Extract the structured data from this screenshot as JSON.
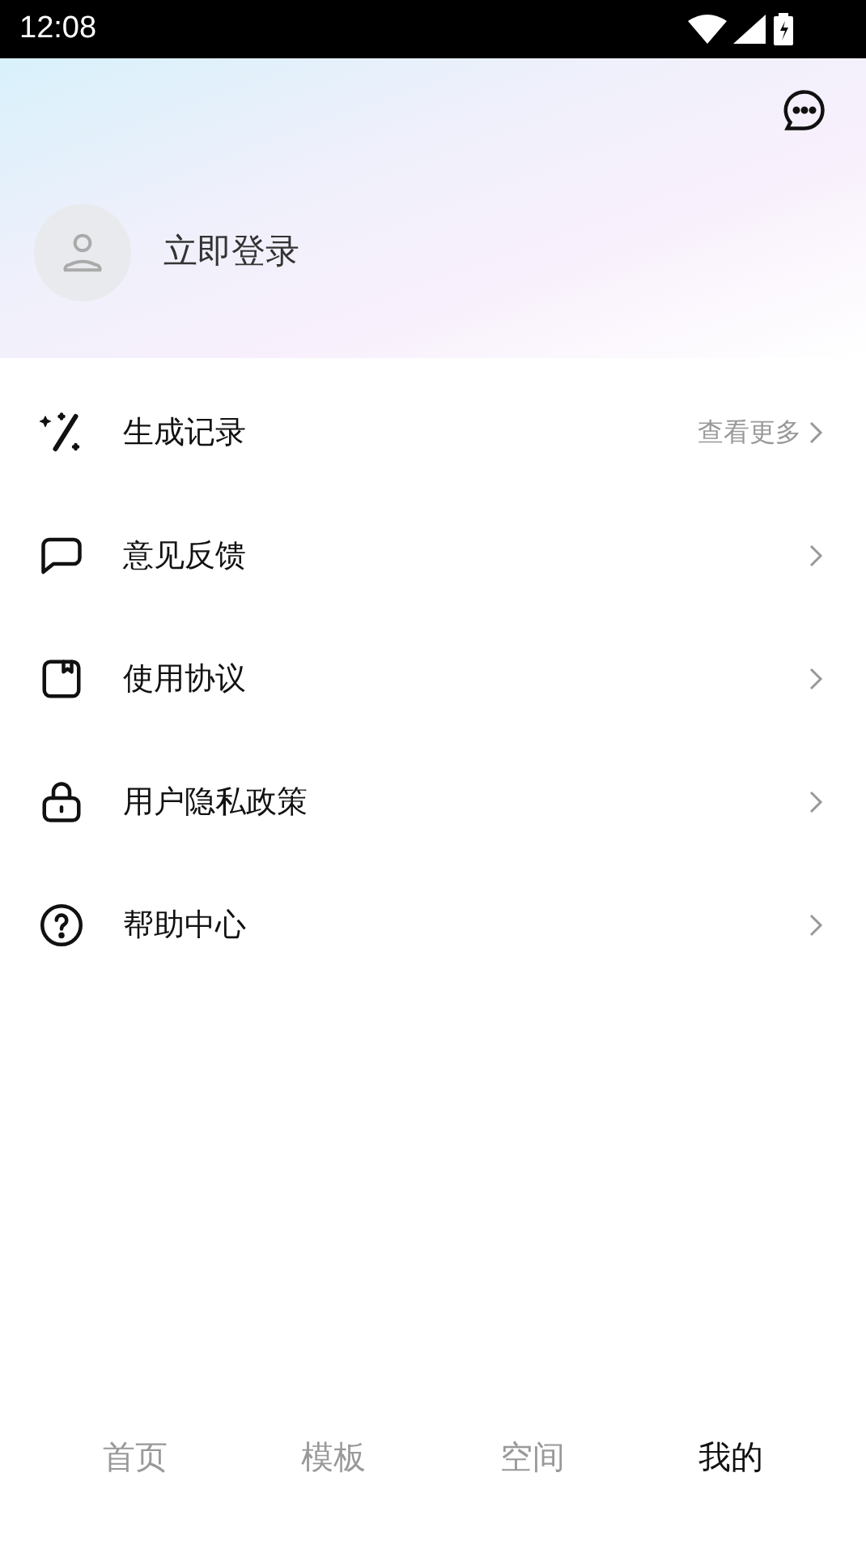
{
  "status_bar": {
    "time": "12:08"
  },
  "profile": {
    "login_label": "立即登录"
  },
  "menu": [
    {
      "kind": "history",
      "label": "生成记录",
      "more": "查看更多"
    },
    {
      "kind": "feedback",
      "label": "意见反馈"
    },
    {
      "kind": "agreement",
      "label": "使用协议"
    },
    {
      "kind": "privacy",
      "label": "用户隐私政策"
    },
    {
      "kind": "help",
      "label": "帮助中心"
    }
  ],
  "tabs": [
    {
      "label": "首页",
      "selected": false
    },
    {
      "label": "模板",
      "selected": false
    },
    {
      "label": "空间",
      "selected": false
    },
    {
      "label": "我的",
      "selected": true
    }
  ]
}
